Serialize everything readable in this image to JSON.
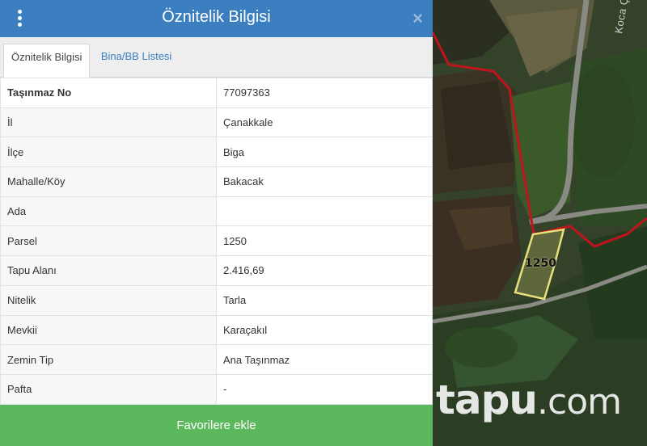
{
  "header": {
    "title": "Öznitelik Bilgisi",
    "close_glyph": "×"
  },
  "tabs": [
    {
      "label": "Öznitelik Bilgisi",
      "active": true
    },
    {
      "label": "Bina/BB Listesi",
      "active": false
    }
  ],
  "attributes": [
    {
      "key": "Taşınmaz No",
      "value": "77097363"
    },
    {
      "key": "İl",
      "value": "Çanakkale"
    },
    {
      "key": "İlçe",
      "value": "Biga"
    },
    {
      "key": "Mahalle/Köy",
      "value": "Bakacak"
    },
    {
      "key": "Ada",
      "value": ""
    },
    {
      "key": "Parsel",
      "value": "1250"
    },
    {
      "key": "Tapu Alanı",
      "value": "2.416,69"
    },
    {
      "key": "Nitelik",
      "value": "Tarla"
    },
    {
      "key": "Mevkii",
      "value": "Karaçakıl"
    },
    {
      "key": "Zemin Tip",
      "value": "Ana Taşınmaz"
    },
    {
      "key": "Pafta",
      "value": "-"
    }
  ],
  "footer": {
    "favorite_label": "Favorilere ekle"
  },
  "map": {
    "parcel_label": "1250",
    "road_label": "Koca Çay",
    "watermark_main": "tapu",
    "watermark_suffix": ".com"
  },
  "colors": {
    "header": "#3b7fc0",
    "favorite_button": "#5cb85c",
    "boundary": "#c0141c",
    "parcel_outline": "#e8df7a"
  }
}
